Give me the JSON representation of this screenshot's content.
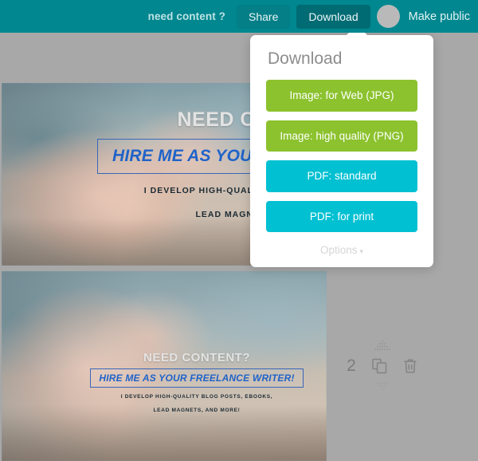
{
  "topbar": {
    "doc_title": "need content ?",
    "share_label": "Share",
    "download_label": "Download",
    "make_public_label": "Make public",
    "teal": "#00878f",
    "avatar_color": "#b9b9b9"
  },
  "download_panel": {
    "title": "Download",
    "buttons": [
      {
        "label": "Image: for Web (JPG)",
        "color": "#8cc22e",
        "style": "green"
      },
      {
        "label": "Image: high quality (PNG)",
        "color": "#8cc22e",
        "style": "green"
      },
      {
        "label": "PDF: standard",
        "color": "#00c0d2",
        "style": "cyan"
      },
      {
        "label": "PDF: for print",
        "color": "#00c0d2",
        "style": "cyan"
      }
    ],
    "options_label": "Options",
    "options_caret": "▾"
  },
  "cards": [
    {
      "heading": "NEED CONTENT?",
      "cta": "HIRE ME AS YOUR FREELANCE WRITER!",
      "subline_1": "I DEVELOP HIGH-QUALITY BLOG POSTS, EBOOKS,",
      "subline_2": "LEAD MAGNETS, AND MORE!",
      "heading_color": "#e3e3e3",
      "cta_color": "#1f63c9"
    },
    {
      "heading": "NEED CONTENT?",
      "cta": "HIRE ME AS YOUR FREELANCE WRITER!",
      "subline_1": "I DEVELOP HIGH-QUALITY BLOG POSTS, EBOOKS,",
      "subline_2": "LEAD MAGNETS, AND MORE!",
      "heading_color": "#e3e3e3",
      "cta_color": "#1f63c9"
    }
  ],
  "row_tools": {
    "row_number": "2",
    "drag_handle_icon": "drag-handle-dots-icon",
    "duplicate_icon": "duplicate-icon",
    "delete_icon": "trash-icon"
  },
  "canvas": {
    "background": "#a8a8a8"
  }
}
